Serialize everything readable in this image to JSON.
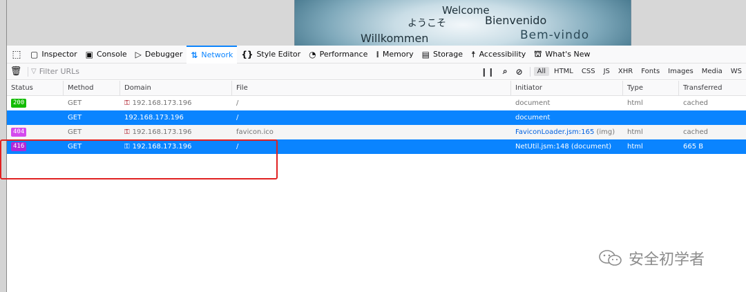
{
  "page": {
    "greetings": {
      "welcome": "Welcome",
      "youkoso": "ようこそ",
      "bienvenido": "Bienvenido",
      "willkommen": "Willkommen",
      "bemvindo": "Bem-vindo"
    }
  },
  "devtools": {
    "tabs": [
      {
        "label": "Inspector",
        "icon": "inspector-icon"
      },
      {
        "label": "Console",
        "icon": "console-icon"
      },
      {
        "label": "Debugger",
        "icon": "debugger-icon"
      },
      {
        "label": "Network",
        "icon": "network-icon",
        "selected": true
      },
      {
        "label": "Style Editor",
        "icon": "style-editor-icon"
      },
      {
        "label": "Performance",
        "icon": "performance-icon"
      },
      {
        "label": "Memory",
        "icon": "memory-icon"
      },
      {
        "label": "Storage",
        "icon": "storage-icon"
      },
      {
        "label": "Accessibility",
        "icon": "accessibility-icon"
      },
      {
        "label": "What's New",
        "icon": "whats-new-icon"
      }
    ],
    "toolbar": {
      "filter_placeholder": "Filter URLs",
      "filters": [
        "All",
        "HTML",
        "CSS",
        "JS",
        "XHR",
        "Fonts",
        "Images",
        "Media",
        "WS"
      ],
      "active_filter": "All"
    },
    "columns": {
      "status": "Status",
      "method": "Method",
      "domain": "Domain",
      "file": "File",
      "initiator": "Initiator",
      "type": "Type",
      "transferred": "Transferred"
    },
    "requests": [
      {
        "status": "200",
        "status_color": "#12bc00",
        "method": "GET",
        "domain": "192.168.173.196",
        "file": "/",
        "initiator": "document",
        "type": "html",
        "transferred": "cached",
        "selected": false
      },
      {
        "status": "",
        "method": "GET",
        "domain": "192.168.173.196",
        "file": "/",
        "initiator": "document",
        "type": "",
        "transferred": "",
        "selected": true
      },
      {
        "status": "404",
        "status_color": "#d44aee",
        "method": "GET",
        "domain": "192.168.173.196",
        "file": "favicon.ico",
        "initiator": "FaviconLoader.jsm:165",
        "initiator_suffix": "(img)",
        "type": "html",
        "transferred": "cached",
        "selected": false
      },
      {
        "status": "416",
        "status_color": "#b028d8",
        "method": "GET",
        "domain": "192.168.173.196",
        "file": "/",
        "initiator": "NetUtil.jsm:148 (document)",
        "type": "html",
        "transferred": "665 B",
        "selected": true
      }
    ]
  },
  "watermark": {
    "text": "安全初学者",
    "icon": "wechat-icon"
  }
}
